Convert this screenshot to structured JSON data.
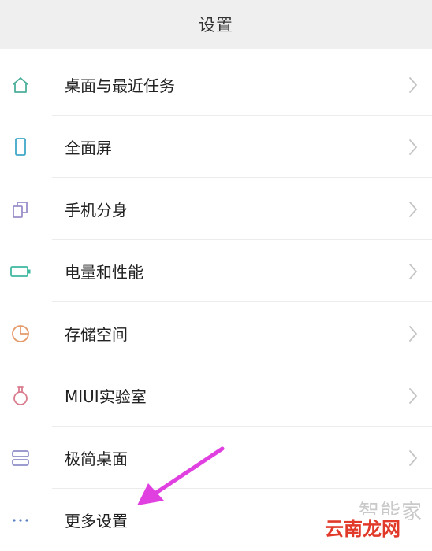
{
  "header": {
    "title": "设置"
  },
  "items": [
    {
      "label": "桌面与最近任务",
      "icon": "home-icon",
      "color": "#4caf9a"
    },
    {
      "label": "全面屏",
      "icon": "phone-icon",
      "color": "#3fa8c8"
    },
    {
      "label": "手机分身",
      "icon": "copy-icon",
      "color": "#9b8ec9"
    },
    {
      "label": "电量和性能",
      "icon": "battery-icon",
      "color": "#3fb8a0"
    },
    {
      "label": "存储空间",
      "icon": "pie-icon",
      "color": "#e59a6a"
    },
    {
      "label": "MIUI实验室",
      "icon": "flask-icon",
      "color": "#d97c8e"
    },
    {
      "label": "极简桌面",
      "icon": "layers-icon",
      "color": "#8e8fc9"
    },
    {
      "label": "更多设置",
      "icon": "more-icon",
      "color": "#5a7fc4"
    }
  ],
  "annotation": {
    "arrow_color": "#e040e0"
  },
  "watermark": {
    "line1": "智能家",
    "line2": "云南龙网"
  }
}
